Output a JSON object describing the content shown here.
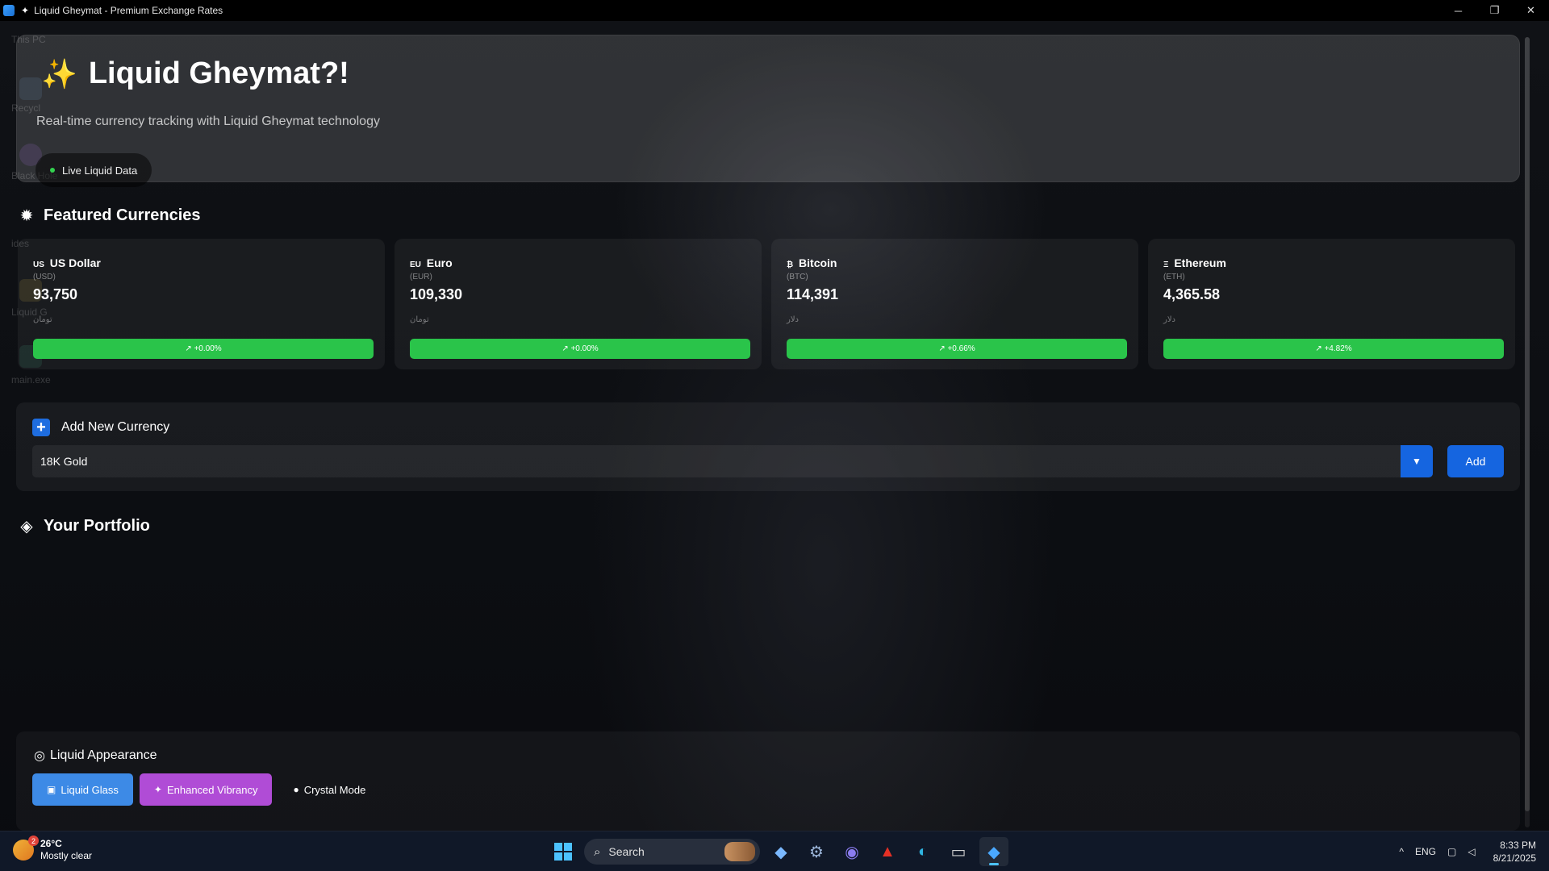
{
  "window": {
    "title": "Liquid Gheymat - Premium Exchange Rates",
    "controls": {
      "minimize": "─",
      "restore": "❐",
      "close": "✕"
    }
  },
  "desktop_ghost_labels": [
    "This PC",
    "Recycl",
    "Black Hole",
    "ides",
    "Liquid G",
    "main.exe"
  ],
  "hero": {
    "icon": "sparkles-icon",
    "title": "Liquid Gheymat?!",
    "subtitle": "Real-time currency tracking with Liquid Gheymat technology",
    "live_label": "Live Liquid Data",
    "live_color": "#33d14f"
  },
  "featured": {
    "icon": "sunburst-icon",
    "title": "Featured Currencies",
    "cards": [
      {
        "flag": "US",
        "name": "US Dollar",
        "code": "(USD)",
        "value": "93,750",
        "unit": "تومان",
        "change": "↗ +0.00%"
      },
      {
        "flag": "EU",
        "name": "Euro",
        "code": "(EUR)",
        "value": "109,330",
        "unit": "تومان",
        "change": "↗ +0.00%"
      },
      {
        "flag": "₿",
        "name": "Bitcoin",
        "code": "(BTC)",
        "value": "114,391",
        "unit": "دلار",
        "change": "↗ +0.66%"
      },
      {
        "flag": "Ξ",
        "name": "Ethereum",
        "code": "(ETH)",
        "value": "4,365.58",
        "unit": "دلار",
        "change": "↗ +4.82%"
      }
    ],
    "change_color": "#2ac44a"
  },
  "add_currency": {
    "icon": "plus-icon",
    "title": "Add New Currency",
    "selected": "18K Gold",
    "chevron": "chevron-down-icon",
    "button_label": "Add",
    "accent": "#1565e0"
  },
  "portfolio": {
    "icon": "gem-icon",
    "title": "Your Portfolio"
  },
  "appearance": {
    "icon": "palette-icon",
    "title": "Liquid Appearance",
    "modes": [
      {
        "label": "Liquid Glass",
        "icon": "glass-icon",
        "color": "#3d8ae6"
      },
      {
        "label": "Enhanced Vibrancy",
        "icon": "sparkle-icon",
        "color": "#b04cd6"
      },
      {
        "label": "Crystal Mode",
        "icon": "crystal-ball-icon",
        "color": "transparent"
      }
    ]
  },
  "taskbar": {
    "weather": {
      "temp": "26°C",
      "condition": "Mostly clear",
      "badge": "2"
    },
    "search_label": "Search",
    "apps": [
      "copilot-icon",
      "settings-icon",
      "messenger-icon",
      "acrobat-icon",
      "edge-icon",
      "terminal-icon",
      "liquid-gheymat-icon"
    ],
    "tray": {
      "chevron": "^",
      "language": "ENG",
      "time": "8:33 PM",
      "date": "8/21/2025"
    }
  }
}
